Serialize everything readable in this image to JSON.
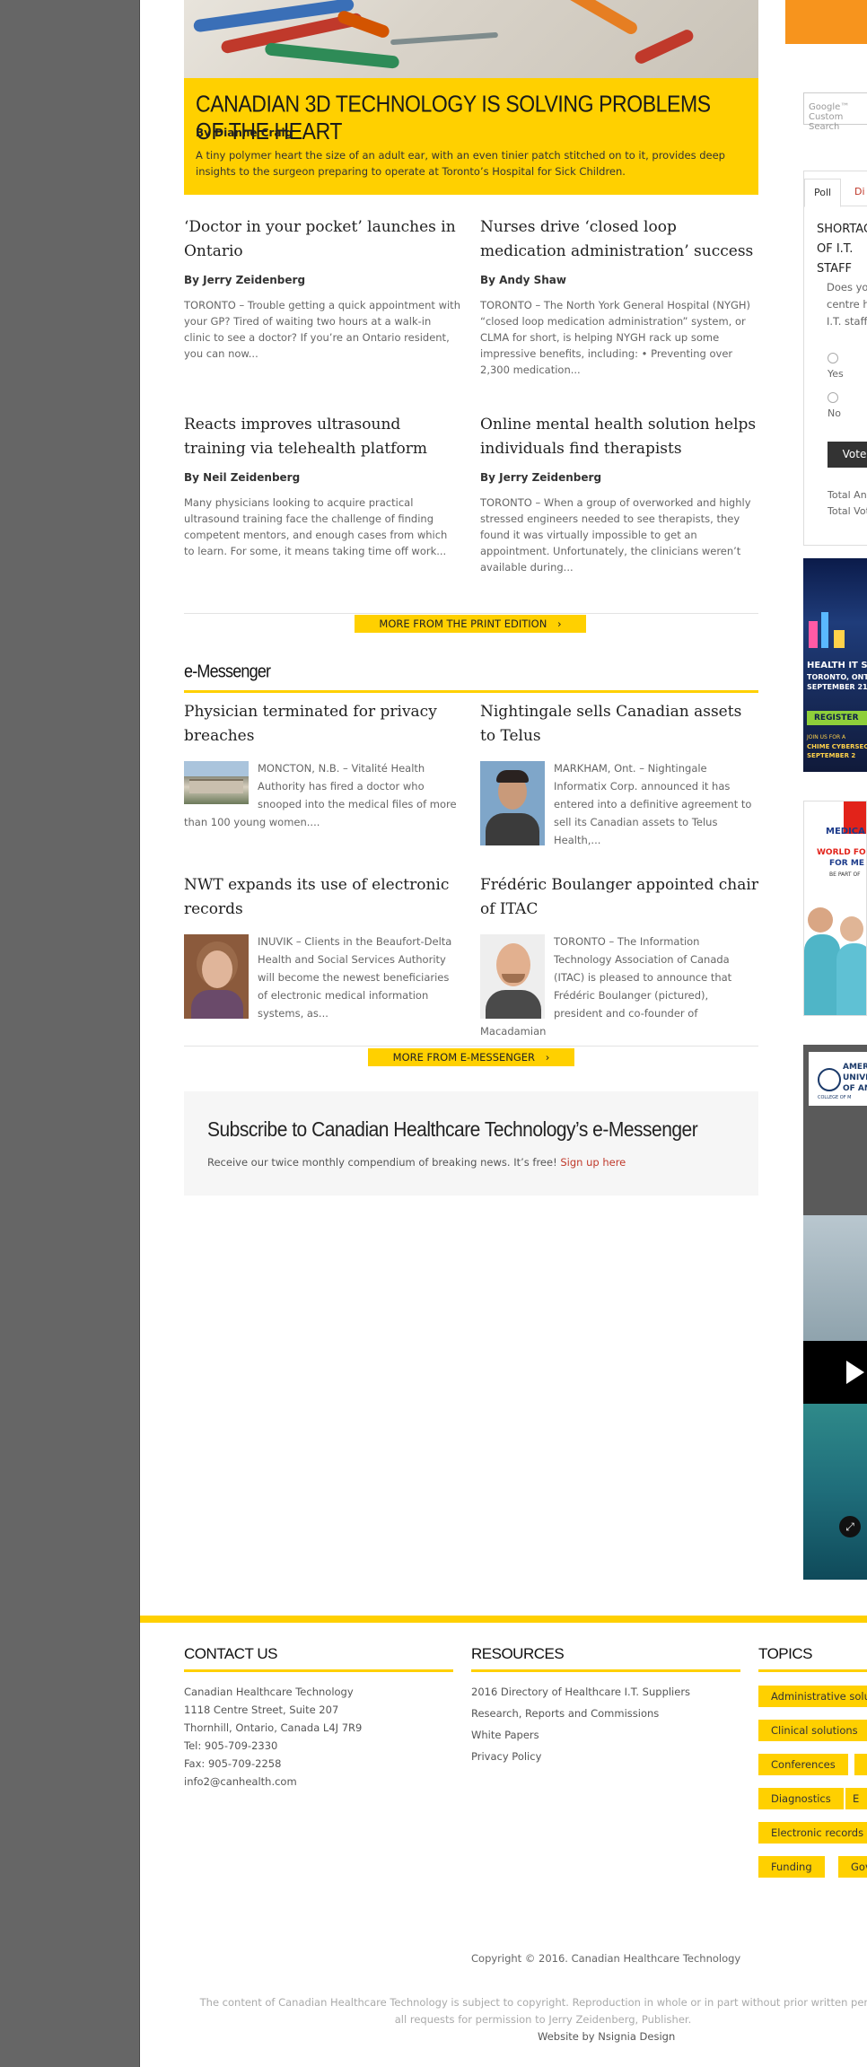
{
  "hero": {
    "title": "CANADIAN 3D TECHNOLOGY IS SOLVING PROBLEMS OF THE HEART",
    "byline": "By Dianne Craig",
    "summary": "A tiny polymer heart the size of an adult ear, with an even tinier patch stitched on to it, provides deep insights to the surgeon preparing to operate at Toronto’s Hospital for Sick Children."
  },
  "articles": [
    {
      "title": "‘Doctor in your pocket’ launches in Ontario",
      "byline": "By Jerry Zeidenberg",
      "text": "TORONTO – Trouble getting a quick appointment with your GP? Tired of waiting two hours at a walk-in clinic to see a doctor? If you’re an Ontario resident, you can now..."
    },
    {
      "title": "Nurses drive ‘closed loop medication administration’ success",
      "byline": "By Andy Shaw",
      "text": "TORONTO – The North York General Hospital (NYGH) “closed loop medication administration” system, or CLMA for short, is helping NYGH rack up some impressive benefits, including: • Preventing over 2,300 medication..."
    },
    {
      "title": "Reacts improves ultrasound training via telehealth platform",
      "byline": "By Neil Zeidenberg",
      "text": "Many physicians looking to acquire practical ultrasound training face the challenge of finding competent mentors, and enough cases from which to learn. For some, it means taking time off work..."
    },
    {
      "title": "Online mental health solution helps individuals find therapists",
      "byline": "By Jerry Zeidenberg",
      "text": "TORONTO – When a group of overworked and highly stressed engineers needed to see therapists, they found it was virtually impossible to get an appointment. Unfortunately, the clinicians weren’t available during..."
    }
  ],
  "more_print": "MORE FROM THE PRINT EDITION",
  "emessenger": {
    "heading": "e-Messenger",
    "items": [
      {
        "title": "Physician terminated for privacy breaches",
        "text": "MONCTON, N.B. – Vitalité Health Authority has fired a doctor who snooped into the medical files of more than 100 young women...."
      },
      {
        "title": "Nightingale sells Canadian assets to Telus",
        "text": "MARKHAM, Ont. – Nightingale Informatix Corp. announced it has entered into a definitive agreement to sell its Canadian assets to Telus Health,..."
      },
      {
        "title": "NWT expands its use of electronic records",
        "text": "INUVIK – Clients in the Beaufort-Delta Health and Social Services Authority will become the newest beneficiaries of electronic medical information systems, as..."
      },
      {
        "title": "Frédéric Boulanger appointed chair of ITAC",
        "text": "TORONTO – The Information Technology Association of Canada (ITAC) is pleased to announce that Frédéric Boulanger (pictured), president and co-founder of Macadamian"
      }
    ],
    "more": "MORE FROM E-MESSENGER"
  },
  "subscribe": {
    "title": "Subscribe to Canadian Healthcare Technology’s e-Messenger",
    "text": "Receive our twice monthly compendium of breaking news. It’s free!",
    "link": "Sign up here"
  },
  "sidebar": {
    "search_placeholder": "Google™ Custom Search",
    "poll": {
      "tab_poll": "Poll",
      "tab_other": "Di",
      "question": "SHORTAGE OF I.T. STAFF",
      "desc_lines": [
        "Does your",
        "centre have",
        "I.T. staff?"
      ],
      "options": [
        "Yes",
        "No"
      ],
      "vote": "Vote",
      "total_answers": "Total Answers",
      "total_voters": "Total Voters"
    },
    "ad1": {
      "line1": "HEALTH IT S",
      "line2": "TORONTO, ONT",
      "line3": "SEPTEMBER 21",
      "cta": "REGISTER",
      "foot1": "JOIN US FOR A",
      "foot2": "CHIME CYBERSECU",
      "foot3": "SEPTEMBER 2"
    },
    "ad2": {
      "top": "MEDICA",
      "line1": "WORLD FO",
      "line2": "FOR ME",
      "line3": "BE PART OF"
    },
    "ad3": {
      "logo1": "AMER",
      "logo2": "UNIVE",
      "logo3": "OF AN",
      "sub": "COLLEGE OF M"
    }
  },
  "footer": {
    "contact": {
      "heading": "CONTACT US",
      "lines": [
        "Canadian Healthcare Technology",
        "1118 Centre Street, Suite 207",
        "Thornhill, Ontario, Canada L4J 7R9",
        "Tel: 905-709-2330",
        "Fax: 905-709-2258",
        "info2@canhealth.com"
      ]
    },
    "resources": {
      "heading": "RESOURCES",
      "links": [
        "2016 Directory of Healthcare I.T. Suppliers",
        "Research, Reports and Commissions",
        "White Papers",
        "Privacy Policy"
      ]
    },
    "topics": {
      "heading": "TOPICS",
      "tags": [
        "Administrative solu",
        "Clinical solutions",
        "Conferences",
        "Diagnostics",
        "Electronic records",
        "Funding",
        "Gove"
      ]
    },
    "copyright": "Copyright © 2016. Canadian Healthcare Technology",
    "disclaimer_line1": "The content of Canadian Healthcare Technology is subject to copyright. Reproduction in whole or in part without prior written permis",
    "disclaimer_line2": "all requests for permission to Jerry Zeidenberg, Publisher.",
    "website": "Website by Nsignia Design"
  },
  "colors": {
    "accent": "#ffd000",
    "gutter": "#666666",
    "link_red": "#c0392b",
    "orange": "#f7941d"
  }
}
